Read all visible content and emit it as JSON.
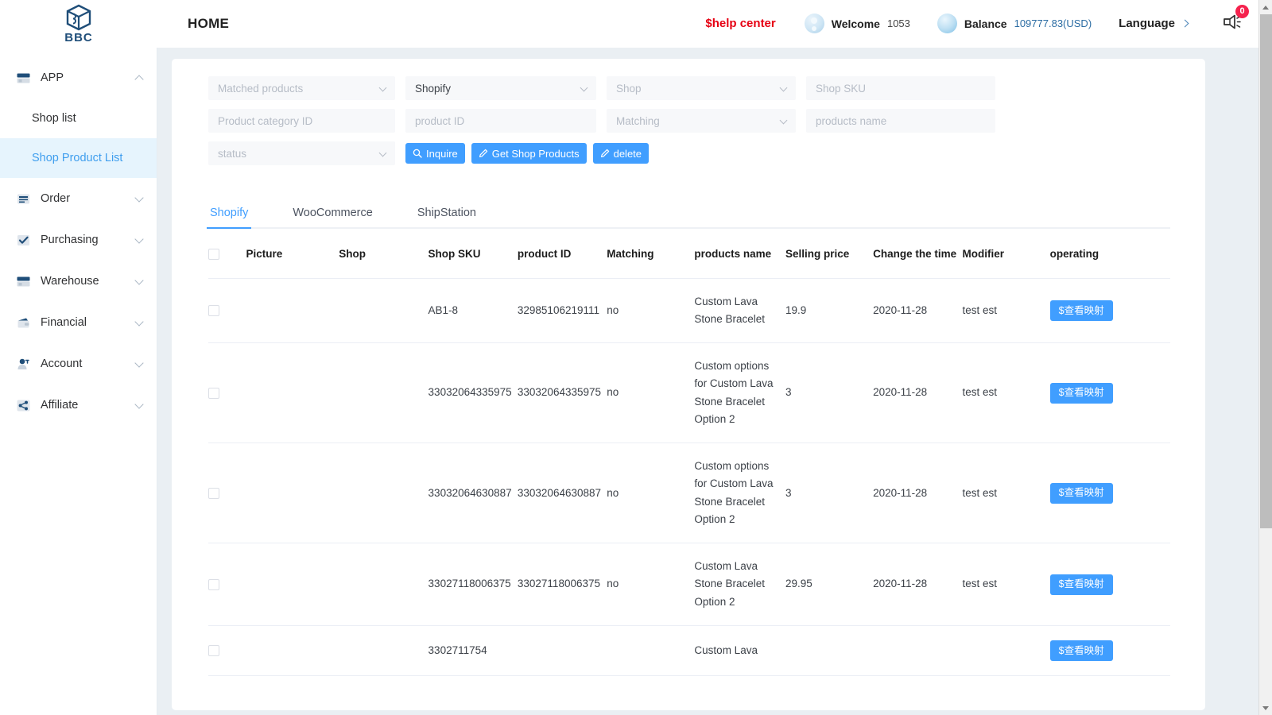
{
  "header": {
    "logo_text": "BBC",
    "page_title": "HOME",
    "help_center": "$help center",
    "welcome_label": "Welcome",
    "welcome_value": "1053",
    "balance_label": "Balance",
    "balance_value": "109777.83(USD)",
    "language": "Language",
    "notify_badge": "0",
    "accent_blue": "#409eff",
    "help_red": "#e60012",
    "badge_red": "#f5224d"
  },
  "sidebar": {
    "items": [
      {
        "label": "APP",
        "icon": "app-icon",
        "expanded": true
      },
      {
        "label": "Order",
        "icon": "order-icon",
        "expanded": false
      },
      {
        "label": "Purchasing",
        "icon": "purchasing-icon",
        "expanded": false
      },
      {
        "label": "Warehouse",
        "icon": "warehouse-icon",
        "expanded": false
      },
      {
        "label": "Financial",
        "icon": "financial-icon",
        "expanded": false
      },
      {
        "label": "Account",
        "icon": "account-icon",
        "expanded": false
      },
      {
        "label": "Affiliate",
        "icon": "affiliate-icon",
        "expanded": false
      }
    ],
    "app_children": [
      {
        "label": "Shop list",
        "active": false
      },
      {
        "label": "Shop Product List",
        "active": true
      }
    ],
    "active_bg": "#e6f4fd",
    "active_color": "#3f9eee"
  },
  "filters": {
    "matched_products": {
      "placeholder": "Matched products",
      "value": ""
    },
    "platform": {
      "placeholder": "Shopify",
      "value": "Shopify"
    },
    "shop": {
      "placeholder": "Shop",
      "value": ""
    },
    "shop_sku": {
      "placeholder": "Shop SKU",
      "value": ""
    },
    "product_category_id": {
      "placeholder": "Product category ID",
      "value": ""
    },
    "product_id": {
      "placeholder": "product ID",
      "value": ""
    },
    "matching": {
      "placeholder": "Matching",
      "value": ""
    },
    "products_name": {
      "placeholder": "products name",
      "value": ""
    },
    "status": {
      "placeholder": "status",
      "value": ""
    },
    "buttons": {
      "inquire": "Inquire",
      "get_shop_products": "Get Shop Products",
      "delete": "delete"
    }
  },
  "tabs": [
    {
      "label": "Shopify",
      "active": true
    },
    {
      "label": "WooCommerce",
      "active": false
    },
    {
      "label": "ShipStation",
      "active": false
    }
  ],
  "table": {
    "columns": [
      "Picture",
      "Shop",
      "Shop SKU",
      "product ID",
      "Matching",
      "products name",
      "Selling price",
      "Change the time",
      "Modifier",
      "operating"
    ],
    "action_label": "$查看映射",
    "rows": [
      {
        "picture": "",
        "shop": "",
        "shop_sku": "AB1-8",
        "product_id": "32985106219111",
        "matching": "no",
        "products_name": "Custom Lava Stone Bracelet",
        "selling_price": "19.9",
        "change_time": "2020-11-28",
        "modifier": "test est"
      },
      {
        "picture": "",
        "shop": "",
        "shop_sku": "33032064335975",
        "product_id": "33032064335975",
        "matching": "no",
        "products_name": "Custom options for Custom Lava Stone Bracelet Option 2",
        "selling_price": "3",
        "change_time": "2020-11-28",
        "modifier": "test est"
      },
      {
        "picture": "",
        "shop": "",
        "shop_sku": "33032064630887",
        "product_id": "33032064630887",
        "matching": "no",
        "products_name": "Custom options for Custom Lava Stone Bracelet Option 2",
        "selling_price": "3",
        "change_time": "2020-11-28",
        "modifier": "test est"
      },
      {
        "picture": "",
        "shop": "",
        "shop_sku": "33027118006375",
        "product_id": "33027118006375",
        "matching": "no",
        "products_name": "Custom Lava Stone Bracelet Option 2",
        "selling_price": "29.95",
        "change_time": "2020-11-28",
        "modifier": "test est"
      },
      {
        "picture": "",
        "shop": "",
        "shop_sku": "3302711754",
        "product_id": "",
        "matching": "",
        "products_name": "Custom Lava",
        "selling_price": "",
        "change_time": "",
        "modifier": ""
      }
    ]
  }
}
